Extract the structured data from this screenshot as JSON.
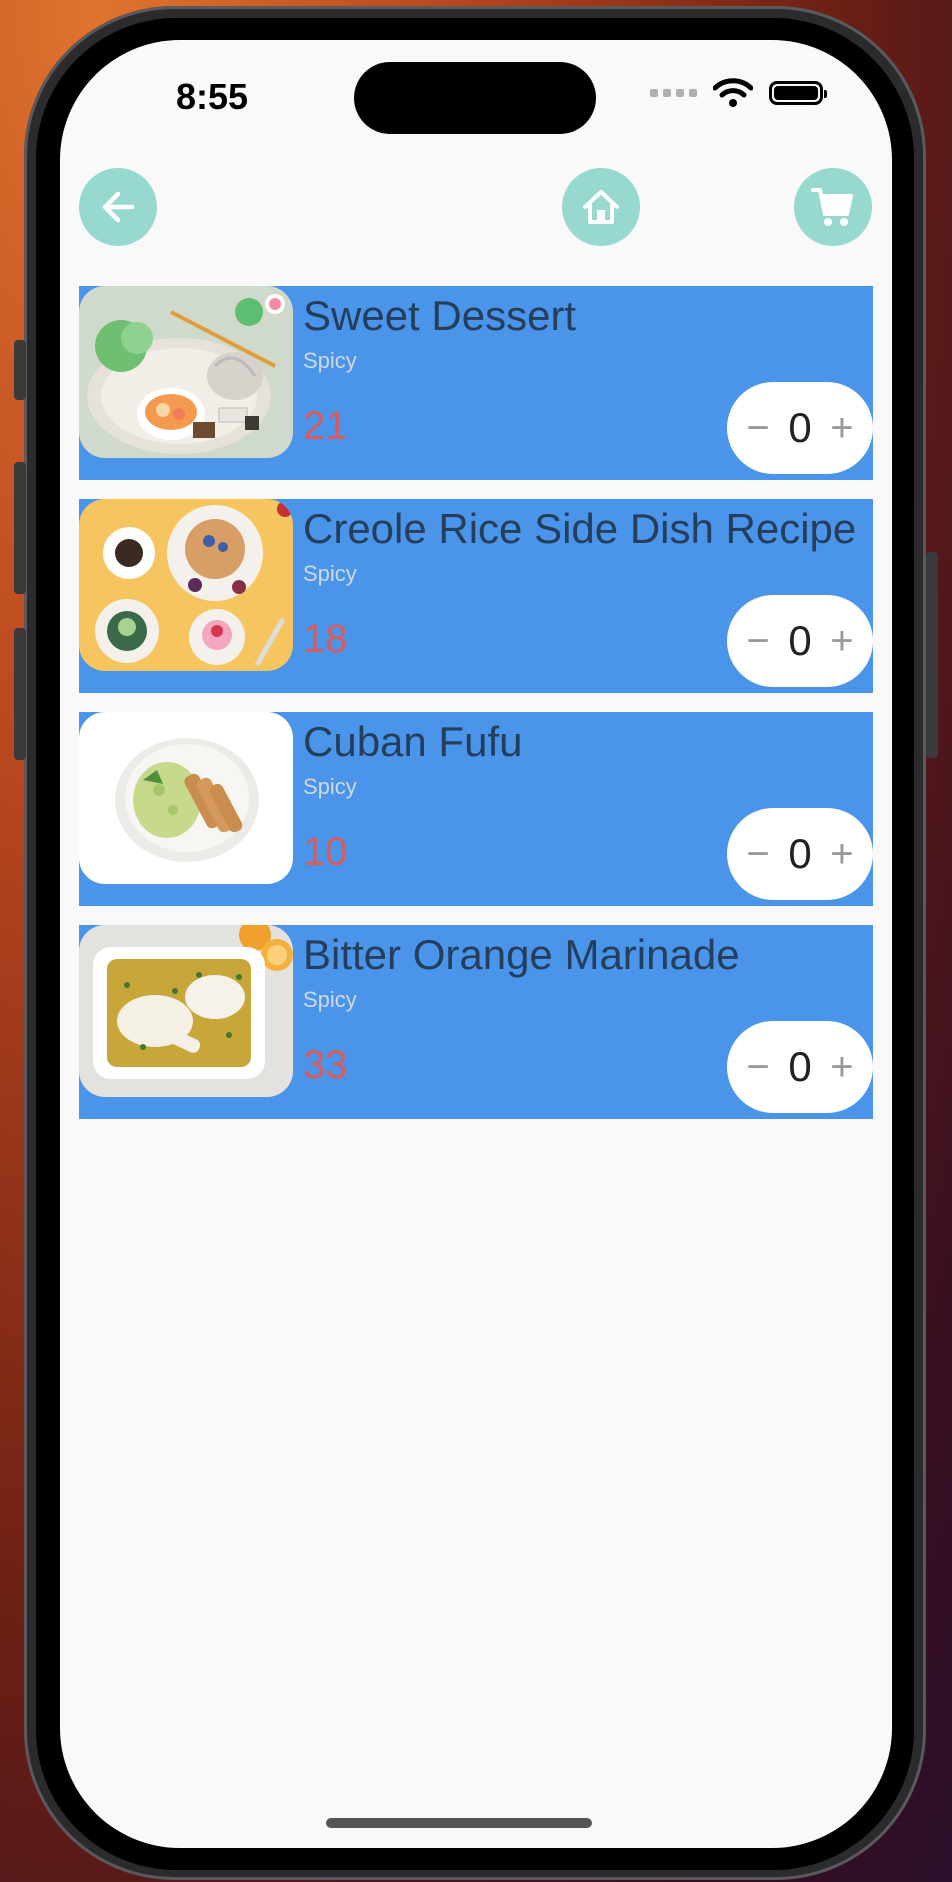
{
  "status_bar": {
    "time": "8:55",
    "icons": [
      "cellular-signal-icon",
      "wifi-icon",
      "battery-icon"
    ]
  },
  "header": {
    "back_icon": "arrow-left-icon",
    "home_icon": "home-icon",
    "cart_icon": "cart-icon"
  },
  "colors": {
    "card_bg": "#4a95ea",
    "nav_button_bg": "#97d9cf",
    "price": "#d95b5b",
    "title": "#253e5c"
  },
  "items": [
    {
      "title": "Sweet Dessert",
      "subtitle": "Spicy",
      "price": "21",
      "quantity": "0",
      "minus": "−",
      "plus": "+"
    },
    {
      "title": "Creole Rice Side Dish Recipe",
      "subtitle": "Spicy",
      "price": "18",
      "quantity": "0",
      "minus": "−",
      "plus": "+"
    },
    {
      "title": "Cuban Fufu",
      "subtitle": "Spicy",
      "price": "10",
      "quantity": "0",
      "minus": "−",
      "plus": "+"
    },
    {
      "title": "Bitter Orange Marinade",
      "subtitle": "Spicy",
      "price": "33",
      "quantity": "0",
      "minus": "−",
      "plus": "+"
    }
  ]
}
